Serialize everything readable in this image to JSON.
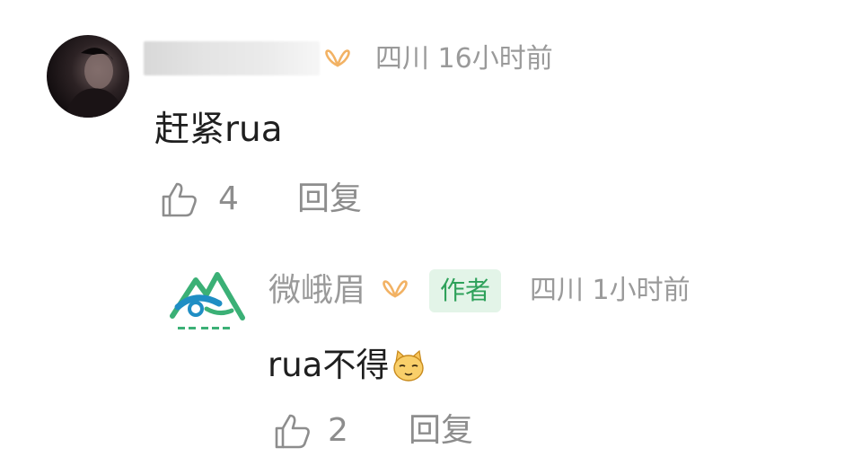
{
  "colors": {
    "meta_gray": "#9a9a9a",
    "action_gray": "#8d8d8d",
    "text": "#1f1f1f",
    "vip_orange": "#f2b264",
    "author_badge_bg": "#e3f4e8",
    "author_badge_text": "#2ea15a",
    "logo_green": "#3bb076",
    "logo_blue": "#1f8ec4"
  },
  "comments": [
    {
      "avatar_icon": "user-avatar-photo",
      "username_blurred": true,
      "vip_icon": "vip-butterfly-icon",
      "location": "四川",
      "time": "16小时前",
      "text": "赶紧rua",
      "like_icon": "thumbs-up-icon",
      "likes": "4",
      "reply_label": "回复"
    },
    {
      "avatar_icon": "emeishan-logo",
      "username": "微峨眉",
      "vip_icon": "vip-butterfly-icon",
      "author_badge": "作者",
      "location": "四川",
      "time": "1小时前",
      "text": "rua不得",
      "emoji_icon": "cat-emoji-icon",
      "like_icon": "thumbs-up-icon",
      "likes": "2",
      "reply_label": "回复"
    }
  ]
}
